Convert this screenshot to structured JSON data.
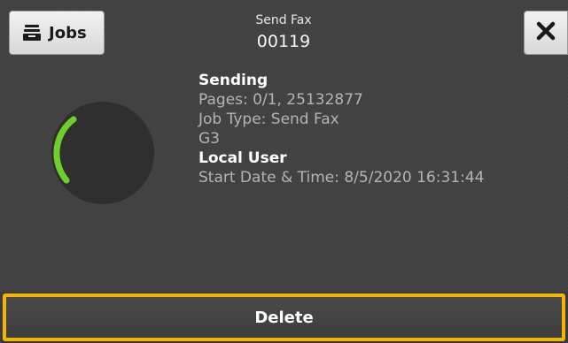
{
  "header": {
    "jobs_label": "Jobs",
    "title": "Send Fax",
    "job_number": "00119"
  },
  "job": {
    "status": "Sending",
    "pages": "Pages: 0/1, 25132877",
    "job_type": "Job Type: Send Fax",
    "line": "G3",
    "user": "Local User",
    "start": "Start Date & Time: 8/5/2020 16:31:44",
    "progress_indicator": {
      "icon": "spinner-arc-icon",
      "accent_color": "#6fcf2a",
      "track_color": "#2e2e2e"
    }
  },
  "actions": {
    "delete_label": "Delete",
    "close_icon": "close-icon",
    "focus_color": "#f2b600"
  }
}
